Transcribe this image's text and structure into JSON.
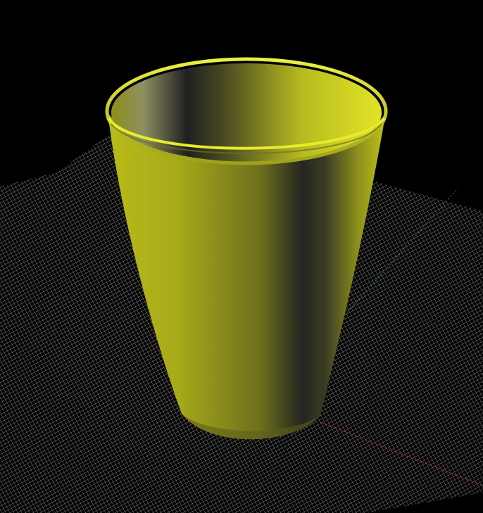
{
  "scene": {
    "background_color": "#000000",
    "grid_color": "#d8d8d8",
    "object": {
      "type": "tapered cup",
      "color": "#c8cc20",
      "highlight_color": "#e6e626",
      "shadow_color": "#2a2c20"
    },
    "axes": {
      "x_color": "#ff3030",
      "y_color": "#30c030"
    }
  }
}
